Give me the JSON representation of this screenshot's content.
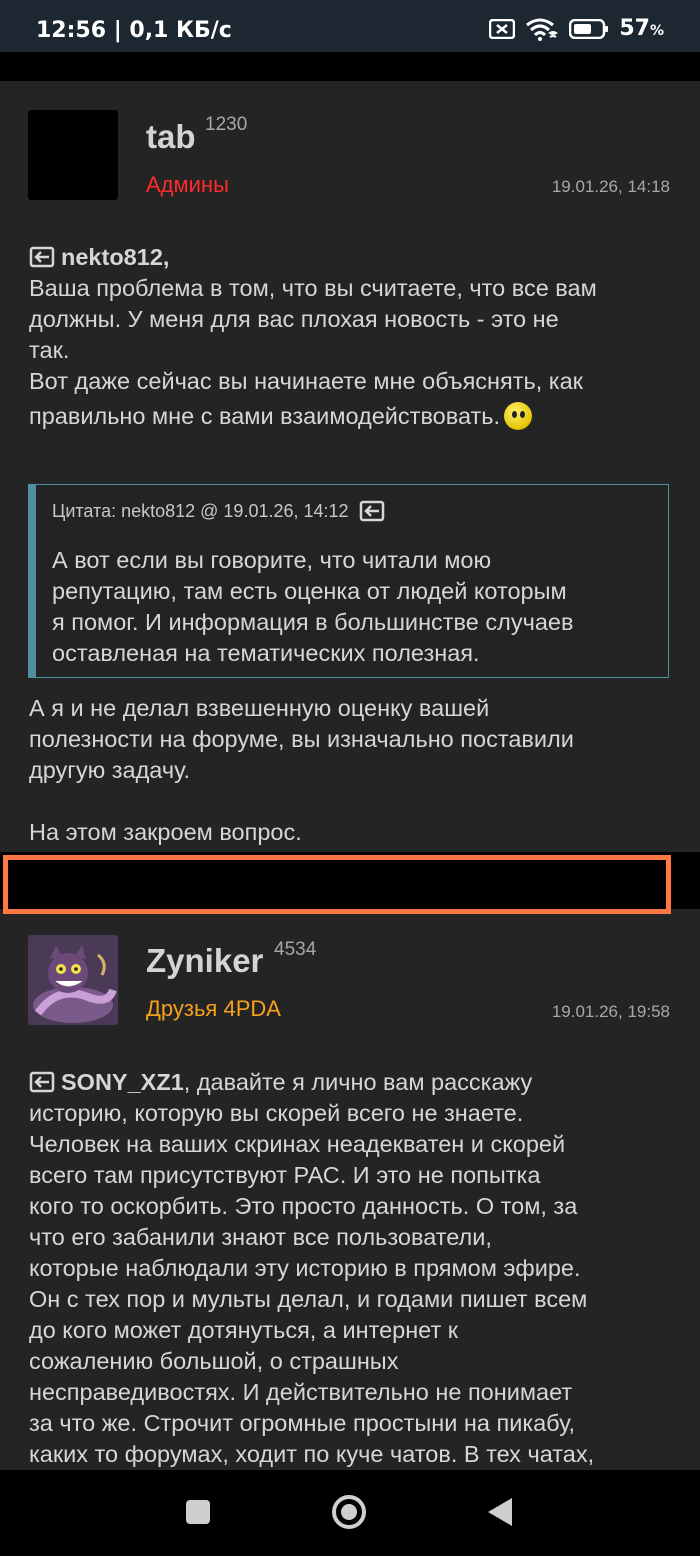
{
  "status_bar": {
    "time_speed": "12:56 | 0,1 КБ/с",
    "battery_pct": "57",
    "battery_unit": "%",
    "icons": [
      "sim-off-icon",
      "wifi-icon",
      "battery-icon"
    ]
  },
  "posts": [
    {
      "username": "tab",
      "reputation": "1230",
      "group": "Админы",
      "group_color": "#ff2b2b",
      "date": "19.01.26, 14:18",
      "reply_to": "nekto812,",
      "lines": [
        "Ваша проблема в том, что вы считаете, что все вам",
        "должны. У меня для вас плохая новость - это не",
        "так.",
        "Вот даже сейчас вы начинаете мне объяснять, как",
        "правильно мне с вами взаимодействовать."
      ],
      "quote": {
        "header": "Цитата: nekto812 @ 19.01.26, 14:12",
        "lines": [
          "А вот если вы говорите, что читали мою",
          "репутацию, там есть оценка от людей которым",
          "я помог. И информация в большинстве случаев",
          "оставленая на тематических полезная."
        ]
      },
      "after_lines": [
        "А я и не делал взвешенную оценку вашей",
        "полезности на форуме, вы изначально поставили",
        "другую задачу.",
        "",
        "На этом закроем вопрос."
      ]
    },
    {
      "username": "Zyniker",
      "reputation": "4534",
      "group": "Друзья 4PDA",
      "group_color": "#f4a21b",
      "date": "19.01.26, 19:58",
      "reply_to": "SONY_XZ1",
      "first_line_rest": ", давайте я лично вам расскажу",
      "lines": [
        "историю, которую вы скорей всего не знаете.",
        "Человек на ваших скринах неадекватен и скорей",
        "всего там присутствуют РАС. И это не попытка",
        "кого то оскорбить. Это просто данность. О том, за",
        "что его забанили знают все пользователи,",
        "которые наблюдали эту историю в прямом эфире.",
        "Он с тех пор и мульты делал, и годами пишет всем",
        "до кого может дотянуться, а интернет к",
        "сожалению большой, о страшных",
        "несправедивостях. И действительно не понимает",
        "за что же. Строчит огромные простыни на пикабу,",
        "каких то форумах, ходит по куче чатов. В тех чатах,"
      ]
    }
  ],
  "navbar": [
    "recents-square-icon",
    "home-circle-icon",
    "back-triangle-icon"
  ]
}
